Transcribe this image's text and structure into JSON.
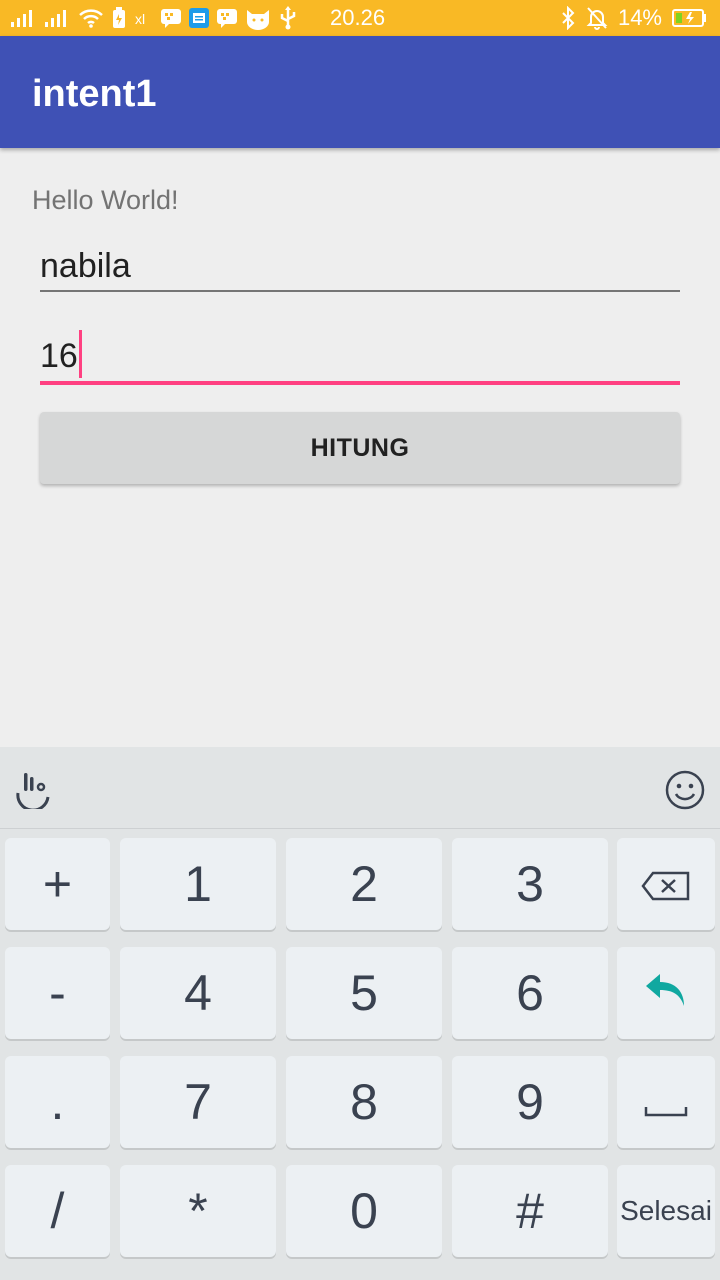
{
  "status_bar": {
    "time": "20.26",
    "battery_percent": "14%",
    "icons": [
      "signal-icon",
      "signal-icon",
      "wifi-icon",
      "battery-saver-icon",
      "data-icon",
      "bbm-icon",
      "message-icon",
      "bbm-icon",
      "cat-icon",
      "usb-icon",
      "bluetooth-icon",
      "mute-icon",
      "battery-icon"
    ]
  },
  "app_bar": {
    "title": "intent1"
  },
  "main": {
    "hello_text": "Hello World!",
    "name_value": "nabila",
    "age_value": "16",
    "button_label": "HITUNG"
  },
  "keyboard": {
    "keys": [
      [
        "+",
        "1",
        "2",
        "3",
        "backspace"
      ],
      [
        "-",
        "4",
        "5",
        "6",
        "enter"
      ],
      [
        ".",
        "7",
        "8",
        "9",
        "space"
      ],
      [
        "/",
        "*",
        "0",
        "#",
        "Selesai"
      ]
    ]
  },
  "colors": {
    "status_bar": "#f9b925",
    "app_bar": "#3f51b5",
    "accent": "#ff4081",
    "enter_icon": "#10a8a0"
  }
}
